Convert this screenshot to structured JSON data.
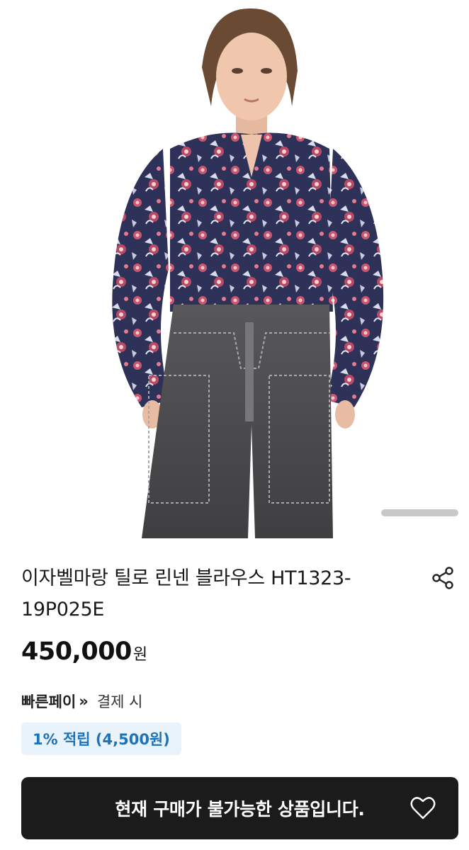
{
  "product": {
    "title": "이자벨마랑 틸로 린넨 블라우스 HT1323-19P025E",
    "price_amount": "450,000",
    "price_currency": "원"
  },
  "payment": {
    "brand": "빠른페이",
    "brand_chevron": "»",
    "note": "결제 시"
  },
  "reward": {
    "label": "1% 적립 (4,500원)"
  },
  "cta": {
    "label": "현재 구매가 불가능한 상품입니다."
  },
  "icons": {
    "share": "share-icon",
    "wishlist": "heart-icon"
  },
  "colors": {
    "cta_background": "#1b1b1b",
    "reward_background": "#e8f3fb",
    "reward_text": "#1e73b8"
  }
}
